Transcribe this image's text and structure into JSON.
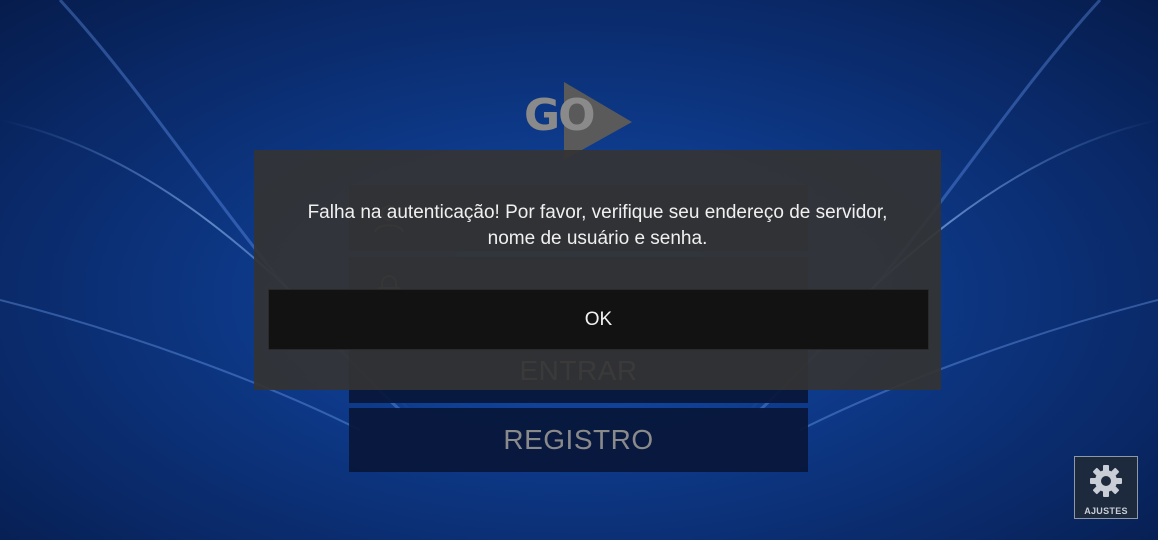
{
  "app": {
    "logo_text": "GO",
    "logo_color": "#8a8a8a"
  },
  "login_form": {
    "username_value": "",
    "password_value": "",
    "login_label": "ENTRAR",
    "register_label": "REGISTRO"
  },
  "settings": {
    "label": "AJUSTES",
    "icon": "gear-icon"
  },
  "dialog": {
    "message_line1": "Falha na autenticação! Por favor, verifique seu endereço de servidor,",
    "message_line2": "nome de usuário e senha.",
    "ok_label": "OK"
  },
  "colors": {
    "background": "#0b2a66",
    "dialog_bg": "#343434",
    "ok_button_bg": "#121212"
  }
}
